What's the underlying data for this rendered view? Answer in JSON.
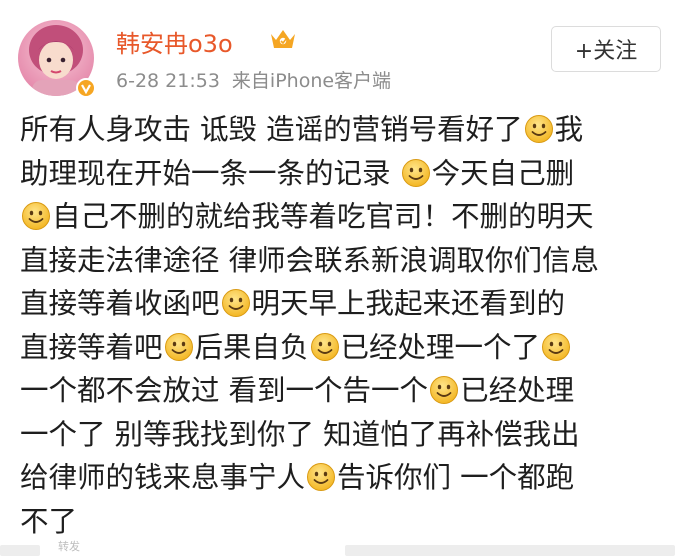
{
  "post_header": {
    "username": "韩安冉o3o",
    "timestamp": "6-28 21:53",
    "source": "来自iPhone客户端",
    "follow_label": "+关注",
    "avatar_icon": "avatar-photo",
    "verified_icon": "verified-badge-icon",
    "member_icon": "vip-member-crown-icon",
    "accent_color": "#e8582a",
    "verified_color": "#f6a623"
  },
  "post_body": {
    "lines": [
      [
        {
          "t": "所有人身攻击 诋毁 造谣的营销号看好了"
        },
        {
          "e": "smile"
        },
        {
          "t": "我"
        }
      ],
      [
        {
          "t": "助理现在开始一条一条的记录 "
        },
        {
          "e": "smile"
        },
        {
          "t": "今天自己删"
        }
      ],
      [
        {
          "e": "smile"
        },
        {
          "t": "自己不删的就给我等着吃官司！不删的明天"
        }
      ],
      [
        {
          "t": "直接走法律途径 律师会联系新浪调取你们信息"
        }
      ],
      [
        {
          "t": "直接等着收函吧"
        },
        {
          "e": "smile"
        },
        {
          "t": "明天早上我起来还看到的"
        }
      ],
      [
        {
          "t": "直接等着吧"
        },
        {
          "e": "smile"
        },
        {
          "t": "后果自负"
        },
        {
          "e": "smile"
        },
        {
          "t": "已经处理一个了"
        },
        {
          "e": "smile"
        }
      ],
      [
        {
          "t": "一个都不会放过 看到一个告一个"
        },
        {
          "e": "smile"
        },
        {
          "t": "已经处理"
        }
      ],
      [
        {
          "t": "一个了 别等我找到你了 知道怕了再补偿我出"
        }
      ],
      [
        {
          "t": "给律师的钱来息事宁人"
        },
        {
          "e": "smile"
        },
        {
          "t": "告诉你们 一个都跑"
        }
      ],
      [
        {
          "t": "不了"
        }
      ]
    ],
    "emoji_name": "smile-emoji-icon"
  },
  "footer": {
    "partial_text": "转发"
  }
}
